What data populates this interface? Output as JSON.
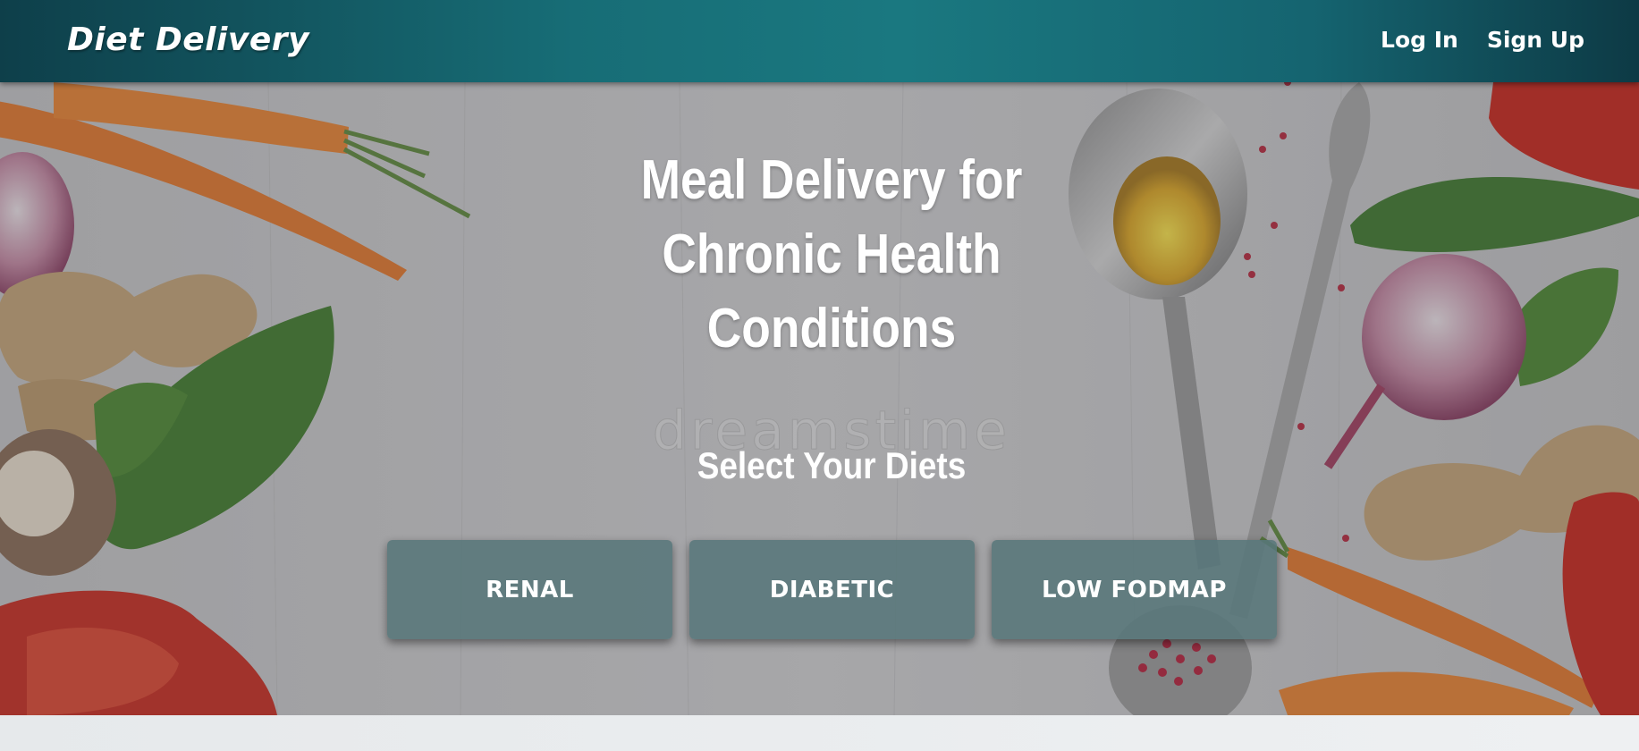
{
  "navbar": {
    "brand": "Diet Delivery",
    "login_label": "Log In",
    "signup_label": "Sign Up"
  },
  "hero": {
    "title": "Meal Delivery for Chronic Health Conditions",
    "watermark": "dreamstime",
    "select_title": "Select Your Diets",
    "diets": [
      "RENAL",
      "DIABETIC",
      "LOW FODMAP"
    ]
  },
  "colors": {
    "navbar_accent": "#1a7880",
    "button_bg": "#58767a",
    "text": "#ffffff"
  }
}
